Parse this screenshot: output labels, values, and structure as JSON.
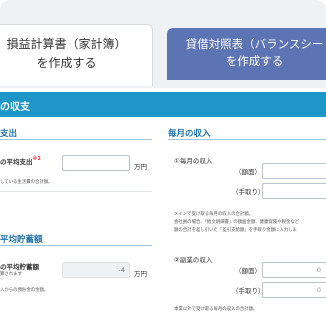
{
  "tabs": {
    "active": {
      "line1": "損益計算書（家計簿）",
      "line2": "を作成する"
    },
    "inactive": {
      "line1": "貸借対照表（バランスシー",
      "line2": "を作成する"
    }
  },
  "section_band": "の収支",
  "left": {
    "heading_expense": "支出",
    "avg_expense_label": "の平均支出",
    "avg_expense_req": "※1",
    "avg_expense_unit": "万円",
    "avg_expense_note": "している生活費の合計額。",
    "heading_savings": "平均貯蓄額",
    "avg_savings_label": "の平均貯蓄額",
    "avg_savings_sub": "算されます",
    "avg_savings_value": "-4",
    "avg_savings_unit": "万円",
    "avg_savings_note": "入からの預貯金の金額。"
  },
  "right": {
    "heading_income": "毎月の収入",
    "main_income_label": "①毎月の収入",
    "gross_label": "（額面）",
    "net_label": "（手取り）",
    "main_note_1": "メインで受け取る毎月の収入の合計額。",
    "main_note_2": "会社員の場合、「給文明細書」の額面金額、健康保険や税金など",
    "main_note_3": "額の合計を差し引いた「差引支給額」を手取り金額に入力しま",
    "side_income_label": "②副業の収入",
    "side_gross_label": "（額面）",
    "side_net_label": "（手取り）",
    "side_gross_value": "0",
    "side_net_value": "0",
    "side_note": "本業以外で受け取る毎月の収入の合計額。"
  },
  "colors": {
    "band": "#1e96c8",
    "inactive_tab": "#5c73b4",
    "heading": "#1e6fa8"
  }
}
